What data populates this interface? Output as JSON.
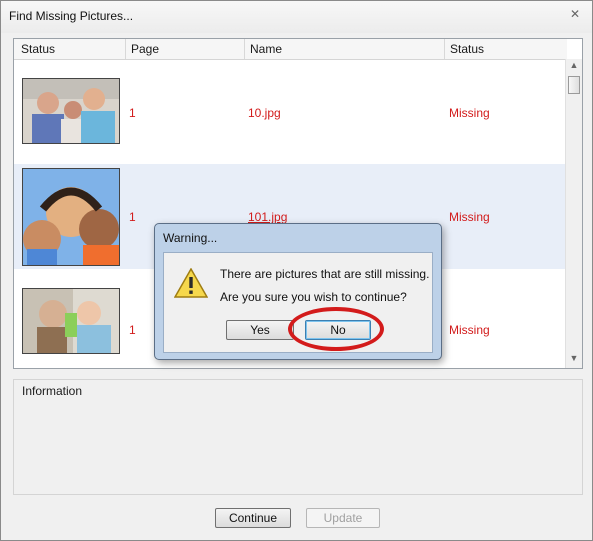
{
  "window": {
    "title": "Find Missing Pictures..."
  },
  "list": {
    "columns": [
      "Status",
      "Page",
      "Name",
      "Status"
    ],
    "rows": [
      {
        "page": "1",
        "name": "10.jpg",
        "status": "Missing"
      },
      {
        "page": "1",
        "name": "101.jpg",
        "status": "Missing"
      },
      {
        "page": "1",
        "name": "",
        "status": "Missing"
      }
    ]
  },
  "info": {
    "label": "Information"
  },
  "buttons": {
    "continue": "Continue",
    "update": "Update"
  },
  "dialog": {
    "title": "Warning...",
    "line1": "There are pictures that are still missing.",
    "line2": "Are you sure you wish to continue?",
    "yes": "Yes",
    "no": "No"
  },
  "icons": {
    "warning": "warning-icon",
    "scroll_up": "chevron-up-icon",
    "scroll_down": "chevron-down-icon",
    "close": "close-icon"
  },
  "colors": {
    "missing_text": "#d21b1b",
    "selection": "#e8eef8",
    "annotation": "#d31b1b"
  }
}
